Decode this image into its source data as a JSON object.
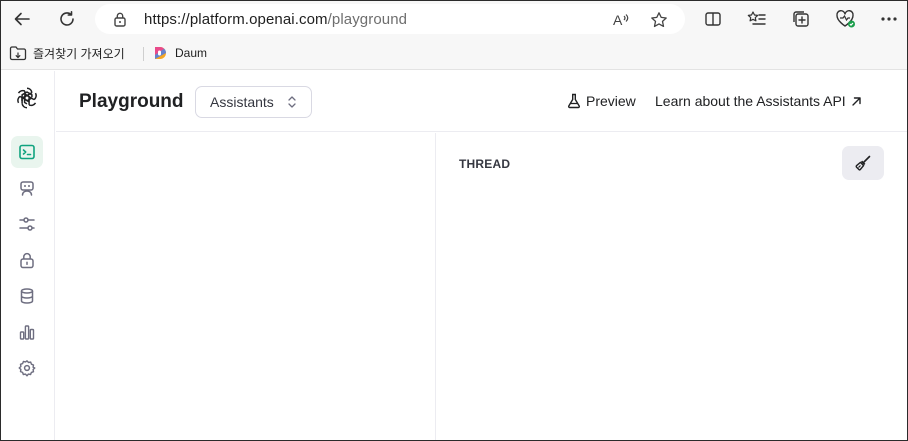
{
  "browser": {
    "url_host": "https://platform.openai.com",
    "url_path": "/playground",
    "favorites": [
      {
        "label": "즐겨찾기 가져오기",
        "icon": "import-favorites-icon"
      },
      {
        "label": "Daum",
        "icon": "daum-logo-icon"
      }
    ]
  },
  "app": {
    "title": "Playground",
    "mode_select": {
      "value": "Assistants"
    },
    "header_links": {
      "preview": "Preview",
      "learn": "Learn about the Assistants API"
    },
    "sidebar": [
      {
        "icon": "terminal-icon",
        "active": true
      },
      {
        "icon": "assistant-bot-icon",
        "active": false
      },
      {
        "icon": "sliders-icon",
        "active": false
      },
      {
        "icon": "lock-icon",
        "active": false
      },
      {
        "icon": "database-icon",
        "active": false
      },
      {
        "icon": "bar-chart-icon",
        "active": false
      },
      {
        "icon": "settings-gear-icon",
        "active": false
      }
    ],
    "thread": {
      "label": "THREAD"
    },
    "colors": {
      "active_accent": "#10a37f",
      "active_bg": "#e9f5ee",
      "text": "#202123"
    }
  }
}
